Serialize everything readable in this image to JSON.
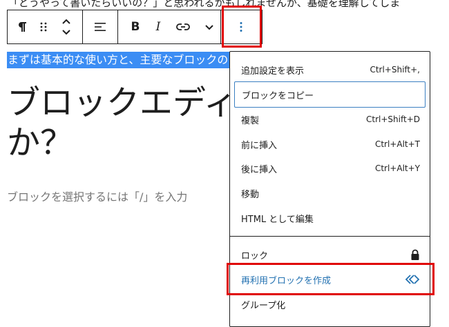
{
  "content": {
    "top_line": "「どうやって書いたらいいの？」と思われるかもしれませんが、基礎を理解してしま",
    "selected_paragraph": "まずは基本的な使い方と、主要なブロックの",
    "heading_line1": "ブロックエディ",
    "heading_line2": "か？",
    "placeholder": "ブロックを選択するには「/」を入力"
  },
  "toolbar": {
    "icons": [
      "paragraph-icon",
      "drag-handle-icon",
      "move-up-down-icon",
      "align-icon",
      "bold-icon",
      "italic-icon",
      "link-icon",
      "chevron-down-icon",
      "more-options-icon"
    ],
    "bold_label": "B",
    "italic_label": "I"
  },
  "menu": {
    "items": [
      {
        "label": "追加設定を表示",
        "shortcut": "Ctrl+Shift+,"
      },
      {
        "label": "ブロックをコピー",
        "shortcut": ""
      },
      {
        "label": "複製",
        "shortcut": "Ctrl+Shift+D"
      },
      {
        "label": "前に挿入",
        "shortcut": "Ctrl+Alt+T"
      },
      {
        "label": "後に挿入",
        "shortcut": "Ctrl+Alt+Y"
      },
      {
        "label": "移動",
        "shortcut": ""
      },
      {
        "label": "HTML として編集",
        "shortcut": ""
      },
      {
        "label": "ロック",
        "icon": "lock-icon"
      },
      {
        "label": "再利用ブロックを作成",
        "icon": "reusable-block-icon"
      },
      {
        "label": "グループ化",
        "shortcut": ""
      }
    ]
  },
  "colors": {
    "highlight_red": "#e00000",
    "selection_blue": "#3b8df4",
    "accent_blue": "#2271b1",
    "text": "#1e1e1e",
    "placeholder": "#757575"
  }
}
